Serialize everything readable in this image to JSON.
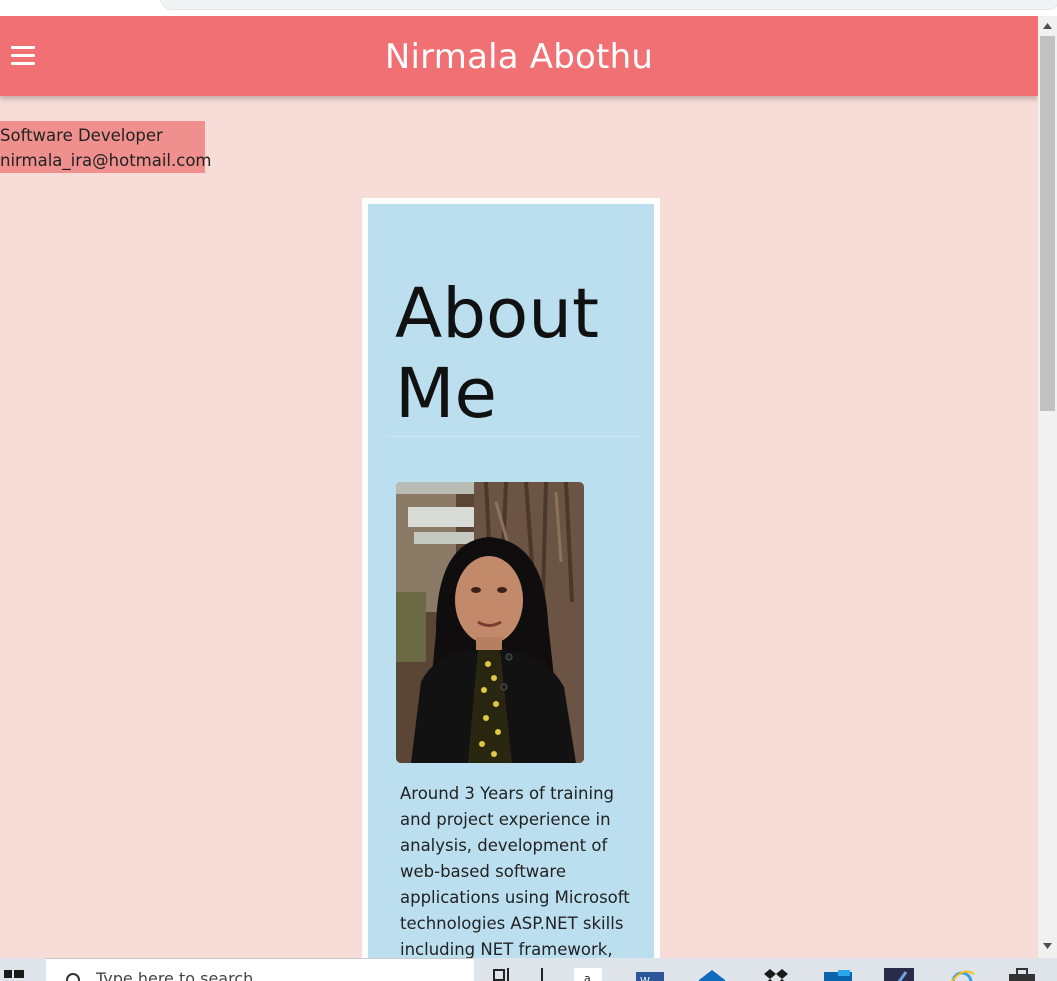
{
  "header": {
    "title": "Nirmala Abothu"
  },
  "profile": {
    "role": "Software Developer",
    "email": "nirmala_ira@hotmail.com"
  },
  "about": {
    "heading_line1": "About",
    "heading_line2": "Me",
    "bio_lines": [
      "Around 3 Years of training",
      "and project experience in",
      "analysis, development of",
      "web-based software",
      "applications using Microsoft",
      "technologies ASP.NET skills",
      "including NET framework,"
    ]
  },
  "taskbar": {
    "search_placeholder": "Type here to search",
    "icons": [
      "task-view-icon",
      "file-explorer-icon",
      "amazon-icon",
      "word-icon",
      "mail-icon",
      "dropbox-icon",
      "outlook-icon",
      "visual-studio-icon",
      "internet-explorer-icon",
      "briefcase-icon"
    ]
  },
  "colors": {
    "app_bar": "#f07074",
    "page_background": "#f8dcd8",
    "info_box": "#f0908e",
    "card_background": "#bcdff0"
  },
  "scroll": {
    "position_fraction": 0.0
  }
}
